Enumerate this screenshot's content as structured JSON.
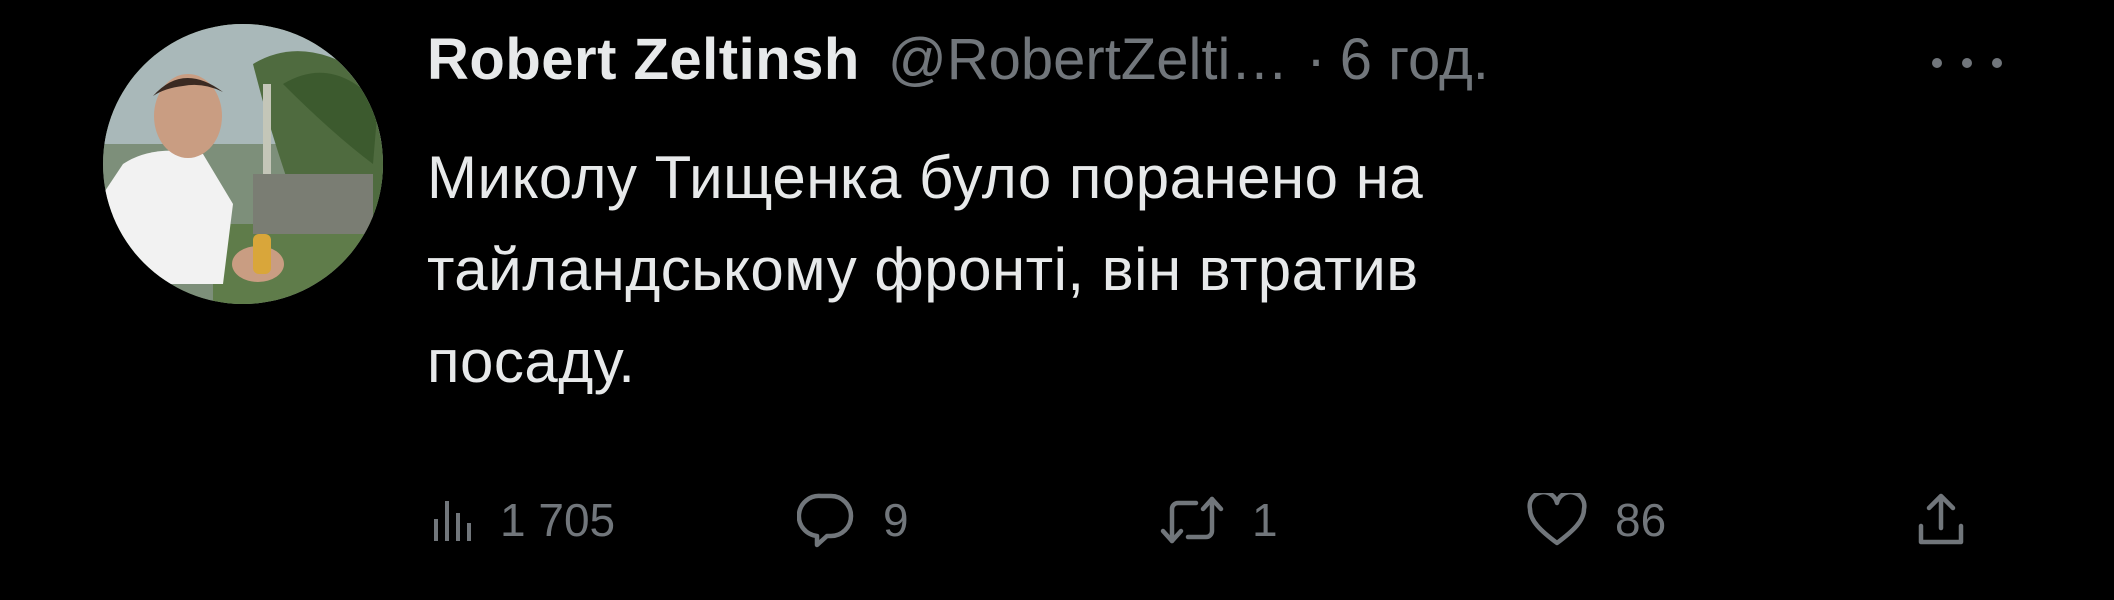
{
  "tweet": {
    "author": {
      "display_name": "Robert Zeltinsh",
      "handle": "@RobertZelti…",
      "avatar": "profile-photo"
    },
    "separator": "·",
    "time": "6 год.",
    "more_icon": "more-horizontal-icon",
    "text_lines": [
      "Миколу Тищенка було поранено на",
      "тайландському фронті, він втратив",
      "посаду."
    ],
    "actions": {
      "views": {
        "icon": "analytics-icon",
        "count": "1 705"
      },
      "replies": {
        "icon": "reply-icon",
        "count": "9"
      },
      "retweets": {
        "icon": "retweet-icon",
        "count": "1"
      },
      "likes": {
        "icon": "heart-icon",
        "count": "86"
      },
      "share": {
        "icon": "share-icon"
      }
    }
  },
  "colors": {
    "background": "#000000",
    "primary_text": "#e7e9ea",
    "secondary_text": "#71767b"
  }
}
